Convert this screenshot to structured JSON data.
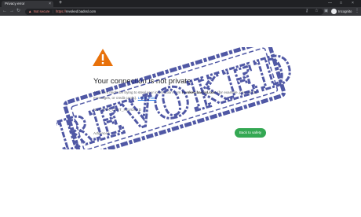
{
  "tab": {
    "title": "Privacy error",
    "close": "×"
  },
  "newtab": "+",
  "window": {
    "minimize": "—",
    "maximize": "□",
    "close": "×"
  },
  "toolbar": {
    "back": "←",
    "forward": "→",
    "reload": "↻",
    "warning_glyph": "▲",
    "not_secure": "Not secure",
    "sep": "|",
    "scheme": "https://",
    "host": "revoked.badssl.com",
    "key_glyph": "⚷",
    "star_glyph": "☆",
    "sidebar_glyph": "▣",
    "incognito_label": "Incognito",
    "menu_glyph": "⋮"
  },
  "error": {
    "title": "Your connection is not private",
    "desc_prefix": "Attackers might be trying to steal your information from ",
    "desc_host": "revoked.badssl.com",
    "desc_suffix": " (for example, passwords, messages, or credit cards). ",
    "learn_more": "Learn more",
    "code": "NET::ERR_CERT_REVOKED",
    "advanced": "Advanced",
    "back_button": "Back to safety"
  },
  "stamp": {
    "text": "REVOKED",
    "color": "#1f2a8c"
  },
  "colors": {
    "accent": "#34a853",
    "warning": "#e8710a",
    "not_secure": "#f28b82",
    "link": "#1a73e8"
  },
  "icons": [
    "close-icon",
    "plus-icon",
    "back-arrow-icon",
    "forward-arrow-icon",
    "reload-icon",
    "warning-icon",
    "key-icon",
    "star-icon",
    "sidebar-icon",
    "avatar-icon",
    "menu-icon",
    "warning-triangle-icon"
  ]
}
